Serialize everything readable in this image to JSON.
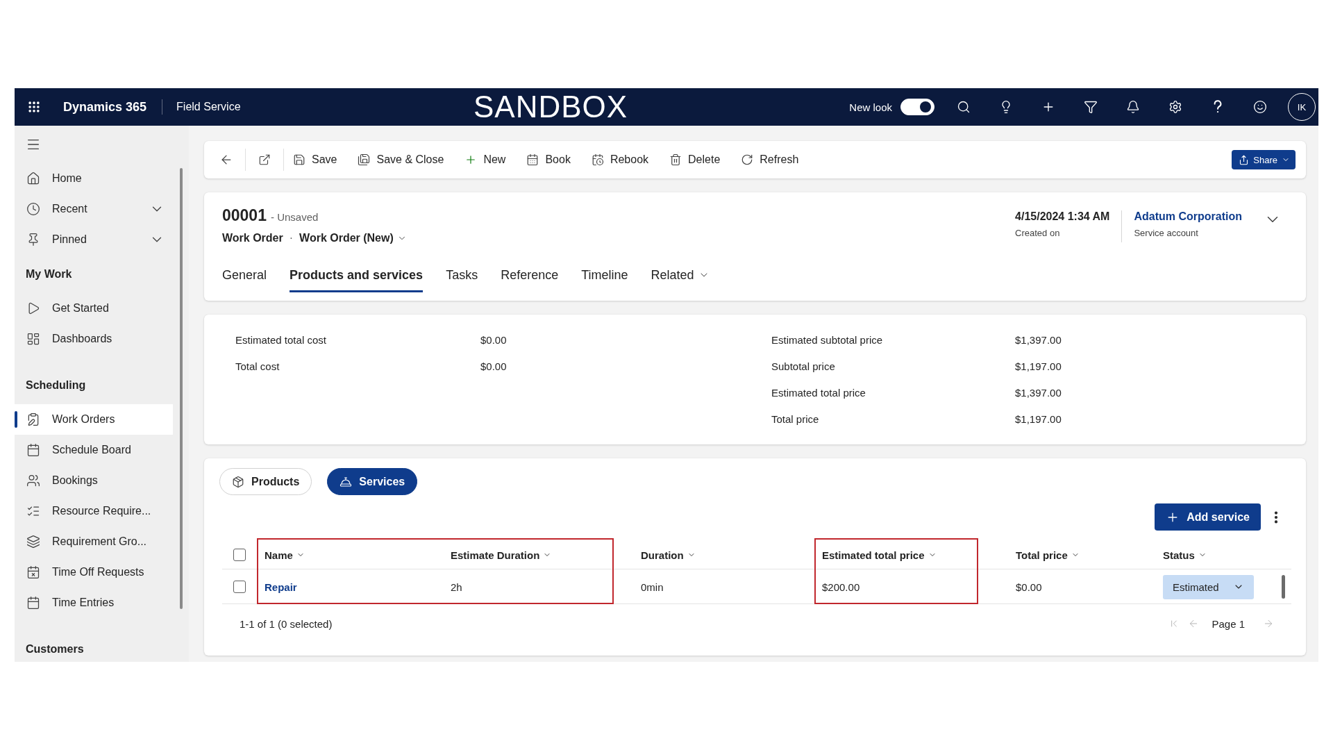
{
  "top_bar": {
    "app_name": "Dynamics 365",
    "area": "Field Service",
    "environment": "SANDBOX",
    "new_look": {
      "label": "New look",
      "on": true
    },
    "avatar": "IK"
  },
  "sidebar": {
    "top_items": [
      {
        "label": "Home",
        "kind": "link",
        "selected": false
      },
      {
        "label": "Recent",
        "kind": "flyout",
        "selected": false
      },
      {
        "label": "Pinned",
        "kind": "flyout",
        "selected": false
      }
    ],
    "groups": [
      {
        "title": "My Work",
        "items": [
          {
            "label": "Get Started",
            "selected": false
          },
          {
            "label": "Dashboards",
            "selected": false
          }
        ]
      },
      {
        "title": "Scheduling",
        "items": [
          {
            "label": "Work Orders",
            "selected": true
          },
          {
            "label": "Schedule Board",
            "selected": false
          },
          {
            "label": "Bookings",
            "selected": false
          },
          {
            "label": "Resource Require...",
            "selected": false
          },
          {
            "label": "Requirement Gro...",
            "selected": false
          },
          {
            "label": "Time Off Requests",
            "selected": false
          },
          {
            "label": "Time Entries",
            "selected": false
          }
        ]
      },
      {
        "title": "Customers"
      }
    ]
  },
  "command_bar": {
    "buttons": [
      {
        "label": "Save"
      },
      {
        "label": "Save & Close"
      },
      {
        "label": "New"
      },
      {
        "label": "Book"
      },
      {
        "label": "Rebook"
      },
      {
        "label": "Delete"
      },
      {
        "label": "Refresh"
      }
    ],
    "share": "Share"
  },
  "record": {
    "number": "00001",
    "status": "- Unsaved",
    "entity": "Work Order",
    "separator": "·",
    "form": "Work Order (New)",
    "created": {
      "value": "4/15/2024 1:34 AM",
      "label": "Created on"
    },
    "account": {
      "value": "Adatum Corporation",
      "label": "Service account"
    },
    "tabs": [
      {
        "label": "General",
        "kind": "tab",
        "selected": false
      },
      {
        "label": "Products and services",
        "kind": "tab",
        "selected": true
      },
      {
        "label": "Tasks",
        "kind": "tab",
        "selected": false
      },
      {
        "label": "Reference",
        "kind": "tab",
        "selected": false
      },
      {
        "label": "Timeline",
        "kind": "tab",
        "selected": false
      },
      {
        "label": "Related",
        "kind": "menu",
        "selected": false
      }
    ]
  },
  "summary": {
    "left": [
      {
        "label": "Estimated total cost",
        "value": "$0.00"
      },
      {
        "label": "Total cost",
        "value": "$0.00"
      }
    ],
    "right": [
      {
        "label": "Estimated subtotal price",
        "value": "$1,397.00"
      },
      {
        "label": "Subtotal price",
        "value": "$1,197.00"
      },
      {
        "label": "Estimated total price",
        "value": "$1,397.00"
      },
      {
        "label": "Total price",
        "value": "$1,197.00"
      }
    ]
  },
  "services_grid": {
    "views": [
      {
        "label": "Products",
        "selected": false
      },
      {
        "label": "Services",
        "selected": true
      }
    ],
    "add_button": "Add service",
    "select_all": {
      "checked": false
    },
    "columns": [
      {
        "label": "Name",
        "kind": "link",
        "highlighted": true
      },
      {
        "label": "Estimate Duration",
        "kind": "text",
        "highlighted": true
      },
      {
        "label": "Duration",
        "kind": "text",
        "highlighted": false
      },
      {
        "label": "Estimated total price",
        "kind": "text",
        "highlighted": true
      },
      {
        "label": "Total price",
        "kind": "text",
        "highlighted": false
      },
      {
        "label": "Status",
        "kind": "choice",
        "highlighted": false
      }
    ],
    "rows": [
      {
        "checked": false,
        "cells": [
          "Repair",
          "2h",
          "0min",
          "$200.00",
          "$0.00",
          "Estimated"
        ]
      }
    ],
    "footer": "1-1 of 1 (0 selected)",
    "page": "Page 1"
  }
}
